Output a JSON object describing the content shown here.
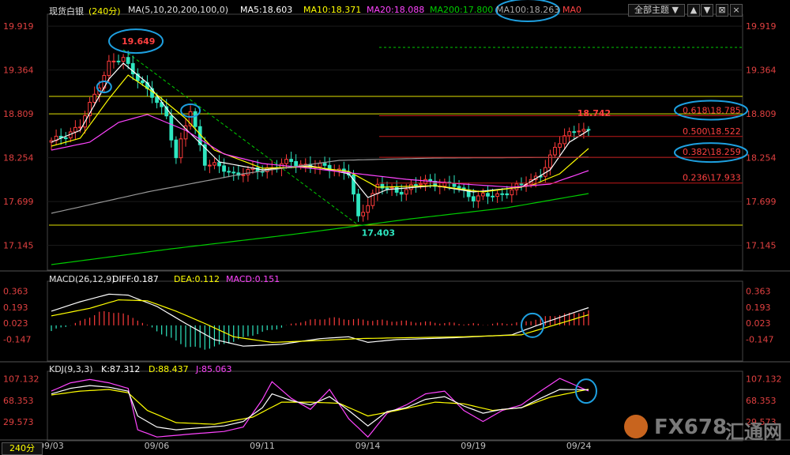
{
  "header": {
    "instrument": "现货白银",
    "period": "(240分)",
    "ma_label": "MA(5,10,20,200,100,0)",
    "ma5": "MA5:18.603",
    "ma10": "MA10:18.371",
    "ma20": "MA20:18.088",
    "ma200": "MA200:17.800",
    "ma100": "MA100:18.263",
    "ma0": "MA0",
    "theme_select": "全部主题",
    "colors": {
      "ma5": "#ffffff",
      "ma10": "#ffff00",
      "ma20": "#ff44ff",
      "ma200": "#00cc00",
      "ma100": "#999999"
    }
  },
  "macd_header": {
    "label": "MACD(26,12,9)",
    "diff": "DIFF:0.187",
    "dea": "DEA:0.112",
    "macd": "MACD:0.151"
  },
  "kdj_header": {
    "label": "KDJ(9,3,3)",
    "k": "K:87.312",
    "d": "D:88.437",
    "j": "J:85.063"
  },
  "bottom": {
    "period_tab": "240分"
  },
  "watermark": {
    "brand": "FX678",
    "cn": "汇通网"
  },
  "chart_data": [
    {
      "type": "candlestick",
      "price_ticks": [
        "19.919",
        "19.364",
        "18.809",
        "18.254",
        "17.699",
        "17.145"
      ],
      "ylim": [
        16.85,
        20.05
      ],
      "date_labels": [
        {
          "i": 0,
          "label": "09/03"
        },
        {
          "i": 22,
          "label": "09/06"
        },
        {
          "i": 44,
          "label": "09/11"
        },
        {
          "i": 66,
          "label": "09/14"
        },
        {
          "i": 88,
          "label": "09/19"
        },
        {
          "i": 110,
          "label": "09/24"
        }
      ],
      "bars": 113,
      "candle_keypoints": [
        [
          0,
          18.45
        ],
        [
          6,
          18.65
        ],
        [
          12,
          19.45
        ],
        [
          15,
          19.5
        ],
        [
          17,
          19.35
        ],
        [
          20,
          19.1
        ],
        [
          24,
          18.8
        ],
        [
          26,
          18.25
        ],
        [
          29,
          18.85
        ],
        [
          32,
          18.2
        ],
        [
          38,
          18.05
        ],
        [
          44,
          18.1
        ],
        [
          50,
          18.2
        ],
        [
          54,
          18.15
        ],
        [
          59,
          18.12
        ],
        [
          62,
          18.05
        ],
        [
          64,
          17.48
        ],
        [
          68,
          17.9
        ],
        [
          72,
          17.82
        ],
        [
          78,
          17.95
        ],
        [
          84,
          17.9
        ],
        [
          88,
          17.75
        ],
        [
          93,
          17.78
        ],
        [
          98,
          17.9
        ],
        [
          102,
          18.05
        ],
        [
          104,
          18.25
        ],
        [
          107,
          18.55
        ],
        [
          110,
          18.62
        ],
        [
          112,
          18.56
        ]
      ],
      "annotations": [
        {
          "label": "19.649",
          "i": 14,
          "value": 19.649
        },
        {
          "label": "17.403",
          "i": 64,
          "value": 17.403
        },
        {
          "label": "18.742",
          "i": 109,
          "value": 18.742
        }
      ],
      "horizontal_lines": [
        {
          "value": 19.03,
          "color": "#e0e000"
        },
        {
          "value": 18.809,
          "color": "#e0e000"
        },
        {
          "value": 17.4,
          "color": "#e0e000"
        },
        {
          "value": 19.65,
          "color": "#00cc00",
          "style": "dashed"
        }
      ],
      "fibonacci": [
        {
          "label": "0.618\\18.785",
          "value": 18.785
        },
        {
          "label": "0.500\\18.522",
          "value": 18.522
        },
        {
          "label": "0.382\\18.259",
          "value": 18.259
        },
        {
          "label": "0.236\\17.933",
          "value": 17.933
        }
      ],
      "ma_series": {
        "ma5": [
          [
            0,
            18.45
          ],
          [
            6,
            18.6
          ],
          [
            12,
            19.25
          ],
          [
            15,
            19.45
          ],
          [
            20,
            19.2
          ],
          [
            25,
            18.8
          ],
          [
            30,
            18.5
          ],
          [
            35,
            18.2
          ],
          [
            44,
            18.1
          ],
          [
            54,
            18.15
          ],
          [
            62,
            18.05
          ],
          [
            66,
            17.75
          ],
          [
            70,
            17.85
          ],
          [
            80,
            17.9
          ],
          [
            88,
            17.82
          ],
          [
            98,
            17.88
          ],
          [
            104,
            18.1
          ],
          [
            108,
            18.45
          ],
          [
            112,
            18.6
          ]
        ],
        "ma10": [
          [
            0,
            18.4
          ],
          [
            6,
            18.5
          ],
          [
            12,
            19.0
          ],
          [
            16,
            19.3
          ],
          [
            22,
            19.05
          ],
          [
            28,
            18.75
          ],
          [
            34,
            18.35
          ],
          [
            44,
            18.12
          ],
          [
            54,
            18.14
          ],
          [
            62,
            18.08
          ],
          [
            68,
            17.88
          ],
          [
            80,
            17.9
          ],
          [
            90,
            17.82
          ],
          [
            100,
            17.9
          ],
          [
            106,
            18.05
          ],
          [
            112,
            18.37
          ]
        ],
        "ma20": [
          [
            0,
            18.35
          ],
          [
            8,
            18.45
          ],
          [
            14,
            18.7
          ],
          [
            20,
            18.8
          ],
          [
            28,
            18.6
          ],
          [
            36,
            18.3
          ],
          [
            44,
            18.18
          ],
          [
            54,
            18.12
          ],
          [
            64,
            18.05
          ],
          [
            74,
            17.98
          ],
          [
            86,
            17.92
          ],
          [
            96,
            17.88
          ],
          [
            104,
            17.92
          ],
          [
            112,
            18.09
          ]
        ],
        "ma100": [
          [
            0,
            17.55
          ],
          [
            20,
            17.82
          ],
          [
            40,
            18.05
          ],
          [
            60,
            18.22
          ],
          [
            80,
            18.25
          ],
          [
            112,
            18.26
          ]
        ],
        "ma200": [
          [
            0,
            16.9
          ],
          [
            25,
            17.1
          ],
          [
            50,
            17.28
          ],
          [
            75,
            17.48
          ],
          [
            95,
            17.62
          ],
          [
            112,
            17.8
          ]
        ]
      }
    },
    {
      "type": "macd",
      "ticks": [
        "0.363",
        "0.193",
        "0.023",
        "-0.147"
      ],
      "ylim": [
        -0.36,
        0.45
      ],
      "diff": [
        [
          0,
          0.15
        ],
        [
          6,
          0.25
        ],
        [
          12,
          0.33
        ],
        [
          16,
          0.32
        ],
        [
          22,
          0.2
        ],
        [
          28,
          0.02
        ],
        [
          34,
          -0.15
        ],
        [
          40,
          -0.22
        ],
        [
          48,
          -0.2
        ],
        [
          56,
          -0.14
        ],
        [
          62,
          -0.12
        ],
        [
          66,
          -0.18
        ],
        [
          72,
          -0.15
        ],
        [
          84,
          -0.13
        ],
        [
          96,
          -0.1
        ],
        [
          104,
          0.05
        ],
        [
          112,
          0.187
        ]
      ],
      "dea": [
        [
          0,
          0.1
        ],
        [
          8,
          0.18
        ],
        [
          14,
          0.27
        ],
        [
          20,
          0.26
        ],
        [
          26,
          0.15
        ],
        [
          32,
          0.02
        ],
        [
          38,
          -0.12
        ],
        [
          46,
          -0.18
        ],
        [
          56,
          -0.16
        ],
        [
          64,
          -0.14
        ],
        [
          74,
          -0.13
        ],
        [
          86,
          -0.12
        ],
        [
          98,
          -0.1
        ],
        [
          106,
          0.02
        ],
        [
          112,
          0.112
        ]
      ],
      "hist": [
        [
          0,
          -0.06
        ],
        [
          6,
          0.04
        ],
        [
          10,
          0.14
        ],
        [
          14,
          0.14
        ],
        [
          18,
          0.06
        ],
        [
          22,
          -0.06
        ],
        [
          28,
          -0.22
        ],
        [
          32,
          -0.25
        ],
        [
          36,
          -0.2
        ],
        [
          42,
          -0.1
        ],
        [
          48,
          -0.02
        ],
        [
          52,
          0.04
        ],
        [
          58,
          0.08
        ],
        [
          64,
          0.06
        ],
        [
          70,
          0.05
        ],
        [
          80,
          0.03
        ],
        [
          90,
          0.01
        ],
        [
          98,
          0.03
        ],
        [
          104,
          0.1
        ],
        [
          112,
          0.151
        ]
      ]
    },
    {
      "type": "kdj",
      "ticks": [
        "107.132",
        "68.353",
        "29.573"
      ],
      "ylim": [
        -2,
        118
      ],
      "k": [
        [
          0,
          80
        ],
        [
          4,
          90
        ],
        [
          8,
          95
        ],
        [
          12,
          92
        ],
        [
          16,
          85
        ],
        [
          18,
          40
        ],
        [
          22,
          20
        ],
        [
          26,
          15
        ],
        [
          30,
          18
        ],
        [
          36,
          22
        ],
        [
          40,
          30
        ],
        [
          44,
          55
        ],
        [
          46,
          80
        ],
        [
          50,
          68
        ],
        [
          54,
          60
        ],
        [
          58,
          75
        ],
        [
          62,
          50
        ],
        [
          66,
          22
        ],
        [
          70,
          48
        ],
        [
          74,
          55
        ],
        [
          78,
          70
        ],
        [
          82,
          75
        ],
        [
          86,
          58
        ],
        [
          90,
          45
        ],
        [
          94,
          52
        ],
        [
          98,
          55
        ],
        [
          102,
          72
        ],
        [
          106,
          88
        ],
        [
          112,
          87.3
        ]
      ],
      "d": [
        [
          0,
          78
        ],
        [
          6,
          85
        ],
        [
          12,
          88
        ],
        [
          16,
          82
        ],
        [
          20,
          50
        ],
        [
          26,
          28
        ],
        [
          34,
          25
        ],
        [
          42,
          38
        ],
        [
          48,
          65
        ],
        [
          54,
          65
        ],
        [
          60,
          63
        ],
        [
          66,
          40
        ],
        [
          72,
          50
        ],
        [
          80,
          65
        ],
        [
          86,
          62
        ],
        [
          92,
          50
        ],
        [
          98,
          55
        ],
        [
          104,
          74
        ],
        [
          112,
          88.4
        ]
      ],
      "j": [
        [
          0,
          85
        ],
        [
          4,
          100
        ],
        [
          8,
          106
        ],
        [
          12,
          100
        ],
        [
          16,
          90
        ],
        [
          18,
          15
        ],
        [
          22,
          2
        ],
        [
          26,
          5
        ],
        [
          30,
          8
        ],
        [
          36,
          12
        ],
        [
          40,
          20
        ],
        [
          44,
          70
        ],
        [
          46,
          102
        ],
        [
          50,
          72
        ],
        [
          54,
          52
        ],
        [
          58,
          88
        ],
        [
          62,
          35
        ],
        [
          66,
          2
        ],
        [
          70,
          45
        ],
        [
          74,
          60
        ],
        [
          78,
          80
        ],
        [
          82,
          85
        ],
        [
          86,
          50
        ],
        [
          90,
          30
        ],
        [
          94,
          50
        ],
        [
          98,
          60
        ],
        [
          102,
          85
        ],
        [
          106,
          108
        ],
        [
          112,
          85.1
        ]
      ]
    }
  ]
}
